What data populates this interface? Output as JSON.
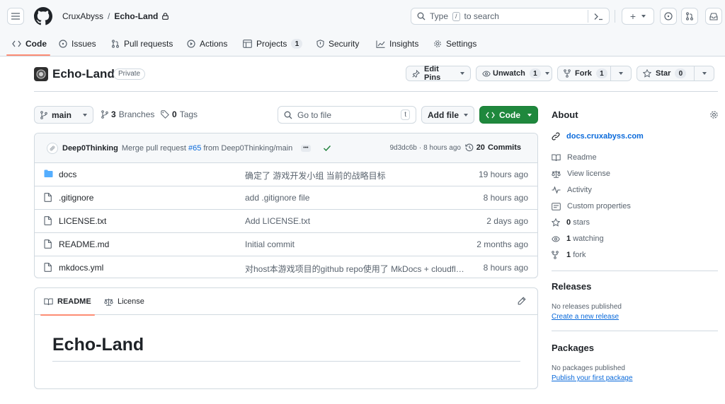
{
  "header": {
    "owner": "CruxAbyss",
    "separator": "/",
    "repo": "Echo-Land",
    "search_before": "Type",
    "search_key": "/",
    "search_after": "to search",
    "plus_label": "+"
  },
  "tabs": [
    {
      "label": "Code",
      "count": ""
    },
    {
      "label": "Issues",
      "count": ""
    },
    {
      "label": "Pull requests",
      "count": ""
    },
    {
      "label": "Actions",
      "count": ""
    },
    {
      "label": "Projects",
      "count": "1"
    },
    {
      "label": "Security",
      "count": ""
    },
    {
      "label": "Insights",
      "count": ""
    },
    {
      "label": "Settings",
      "count": ""
    }
  ],
  "repo": {
    "title": "Echo-Land",
    "visibility": "Private",
    "edit_pins": "Edit Pins",
    "unwatch": "Unwatch",
    "watch_count": "1",
    "fork": "Fork",
    "fork_count": "1",
    "star": "Star",
    "star_count": "0"
  },
  "toolbar": {
    "branch": "main",
    "branches_count": "3",
    "branches_label": "Branches",
    "tags_count": "0",
    "tags_label": "Tags",
    "goto_placeholder": "Go to file",
    "goto_key": "t",
    "add_file": "Add file",
    "code": "Code"
  },
  "commit": {
    "author": "Deep0Thinking",
    "message_prefix": "Merge pull request",
    "pr": "#65",
    "message_suffix": "from Deep0Thinking/main",
    "ellipsis": "•••",
    "sha": "9d3dc6b",
    "dot": "·",
    "time": "8 hours ago",
    "commits_count": "20",
    "commits_label": "Commits"
  },
  "files": [
    {
      "name": "docs",
      "type": "folder",
      "message": "确定了 游戏开发小组 当前的战略目标",
      "age": "19 hours ago"
    },
    {
      "name": ".gitignore",
      "type": "file",
      "message": "add .gitignore file",
      "age": "8 hours ago"
    },
    {
      "name": "LICENSE.txt",
      "type": "file",
      "message": "Add LICENSE.txt",
      "age": "2 days ago"
    },
    {
      "name": "README.md",
      "type": "file",
      "message": "Initial commit",
      "age": "2 months ago"
    },
    {
      "name": "mkdocs.yml",
      "type": "file",
      "message": "对host本游戏项目的github repo使用了 MkDocs + cloudfla...",
      "age": "8 hours ago"
    }
  ],
  "readme": {
    "tab_readme": "README",
    "tab_license": "License",
    "heading": "Echo-Land"
  },
  "about": {
    "title": "About",
    "website": "docs.cruxabyss.com",
    "readme": "Readme",
    "license": "View license",
    "activity": "Activity",
    "custom": "Custom properties",
    "stars_count": "0",
    "stars_label": "stars",
    "watching_count": "1",
    "watching_label": "watching",
    "fork_count": "1",
    "fork_label": "fork"
  },
  "releases": {
    "title": "Releases",
    "empty": "No releases published",
    "link": "Create a new release"
  },
  "packages": {
    "title": "Packages",
    "empty": "No packages published",
    "link": "Publish your first package"
  },
  "colors": {
    "accent": "#0969da",
    "green": "#1f883d",
    "tab_underline": "#fd8c73"
  }
}
